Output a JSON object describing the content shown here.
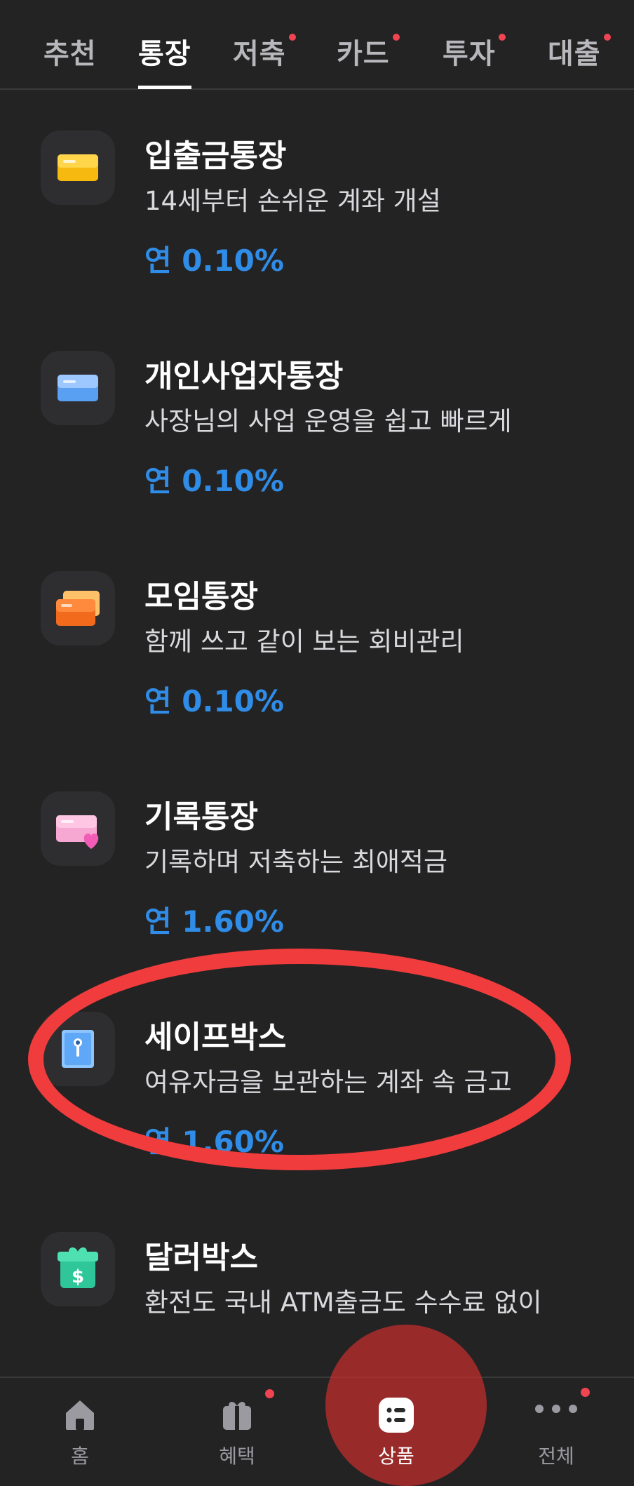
{
  "tabs": [
    {
      "label": "추천",
      "active": false,
      "dot": false
    },
    {
      "label": "통장",
      "active": true,
      "dot": false
    },
    {
      "label": "저축",
      "active": false,
      "dot": true
    },
    {
      "label": "카드",
      "active": false,
      "dot": true
    },
    {
      "label": "투자",
      "active": false,
      "dot": true
    },
    {
      "label": "대출",
      "active": false,
      "dot": true
    }
  ],
  "products": [
    {
      "title": "입출금통장",
      "desc": "14세부터 손쉬운 계좌 개설",
      "rate": "연 0.10%",
      "icon": "yellow-card-icon"
    },
    {
      "title": "개인사업자통장",
      "desc": "사장님의 사업 운영을 쉽고 빠르게",
      "rate": "연 0.10%",
      "icon": "blue-card-icon"
    },
    {
      "title": "모임통장",
      "desc": "함께 쓰고 같이 보는 회비관리",
      "rate": "연 0.10%",
      "icon": "stacked-cards-icon"
    },
    {
      "title": "기록통장",
      "desc": "기록하며 저축하는 최애적금",
      "rate": "연 1.60%",
      "icon": "heart-card-icon"
    },
    {
      "title": "세이프박스",
      "desc": "여유자금을 보관하는 계좌 속 금고",
      "rate": "연 1.60%",
      "icon": "safe-box-icon"
    },
    {
      "title": "달러박스",
      "desc": "환전도 국내 ATM출금도 수수료 없이",
      "rate": "",
      "icon": "dollar-gift-icon"
    }
  ],
  "bottom_nav": [
    {
      "label": "홈",
      "icon": "home-icon",
      "active": false
    },
    {
      "label": "혜택",
      "icon": "gift-icon",
      "active": false
    },
    {
      "label": "상품",
      "icon": "product-list-icon",
      "active": true
    },
    {
      "label": "전체",
      "icon": "more-dots-icon",
      "active": false
    }
  ],
  "colors": {
    "background": "#232324",
    "rate_blue": "#2f8de8",
    "notification_dot": "#f04452",
    "annotation_red": "#f03c3c"
  }
}
